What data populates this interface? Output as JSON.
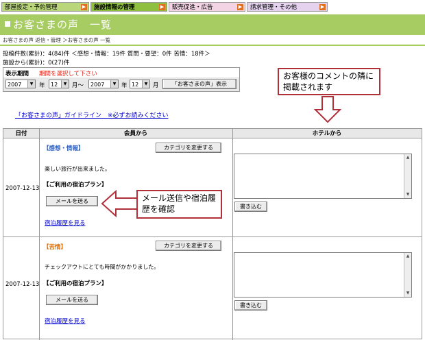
{
  "tabs": [
    {
      "label": "部屋設定・予約管理"
    },
    {
      "label": "施設情報の管理"
    },
    {
      "label": "販売促進・広告"
    },
    {
      "label": "請求管理・その他"
    }
  ],
  "page_title": "お客さまの声　一覧",
  "breadcrumb": "お客さまの声 返信・管理 ＞お客さまの声 一覧",
  "stats": {
    "line1": "投稿件数(累計)：4(84)件 ＜感想・情報：19件 質問・要望：0件 苦情：18件＞",
    "line2": "施設から(累計)：0(27)件"
  },
  "period": {
    "label": "表示期間",
    "note": "期間を選択して下さい",
    "from_year": "2007",
    "from_month": "12",
    "to_year": "2007",
    "to_month": "12",
    "year_unit": "年",
    "month_unit_from": "月～",
    "month_unit_to": "月",
    "show_button": "「お客さまの声」表示"
  },
  "guideline_link": "「お客さまの声」ガイドライン　※必ずお読みください",
  "table": {
    "headers": {
      "date": "日付",
      "member": "会員から",
      "hotel": "ホテルから"
    },
    "rows": [
      {
        "date": "2007-12-13",
        "category_open": "【",
        "category": "感想・情報",
        "category_close": "】",
        "change_category": "カテゴリを変更する",
        "comment": "楽しい旅行が出来ました。",
        "plan_label": "【ご利用の宿泊プラン】",
        "mail_button": "メールを送る",
        "history_link": "宿泊履歴を見る",
        "write_button": "書き込む"
      },
      {
        "date": "2007-12-13",
        "category_open": "【",
        "category": "苦情",
        "category_close": "】",
        "change_category": "カテゴリを変更する",
        "comment": "チェックアウトにとても時間がかかりました。",
        "plan_label": "【ご利用の宿泊プラン】",
        "mail_button": "メールを送る",
        "history_link": "宿泊履歴を見る",
        "write_button": "書き込む"
      }
    ]
  },
  "callouts": {
    "top": "お客様のコメントの隣に掲載されます",
    "mail": "メール送信や宿泊履歴を確認"
  },
  "colors": {
    "brand_green": "#a7cc62",
    "callout_red": "#b0303a",
    "note_red": "#e0281c"
  }
}
